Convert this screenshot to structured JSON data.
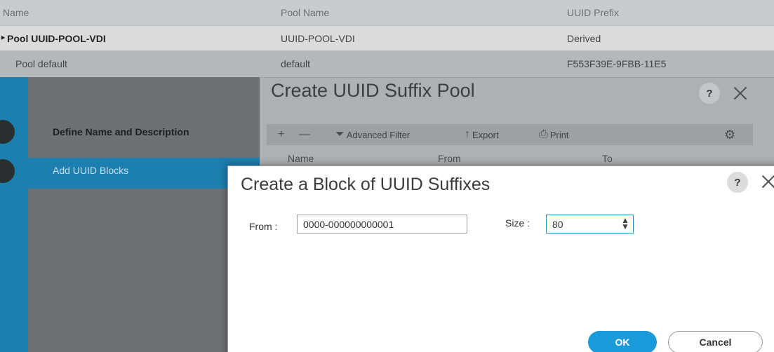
{
  "background_table": {
    "headers": [
      "Name",
      "Pool Name",
      "UUID Prefix"
    ],
    "rows": [
      {
        "name": "Pool UUID-POOL-VDI",
        "pool_name": "UUID-POOL-VDI",
        "prefix": "Derived"
      },
      {
        "name": "Pool default",
        "pool_name": "default",
        "prefix": "F553F39E-9FBB-11E5"
      }
    ]
  },
  "wizard": {
    "title": "Create UUID Suffix Pool",
    "help": "?",
    "steps": [
      "Define Name and Description",
      "Add UUID Blocks"
    ],
    "toolbar": {
      "advanced_filter": "Advanced Filter",
      "export": "Export",
      "print": "Print"
    },
    "columns": [
      "Name",
      "From",
      "To"
    ]
  },
  "modal": {
    "title": "Create a Block of UUID Suffixes",
    "help": "?",
    "from_label": "From :",
    "from_value": "0000-000000000001",
    "size_label": "Size :",
    "size_value": "80",
    "ok_label": "OK",
    "cancel_label": "Cancel"
  },
  "icons": {
    "add": "add-icon",
    "remove": "remove-icon",
    "filter": "filter-icon",
    "export": "export-icon",
    "print": "print-icon",
    "settings": "gear-icon",
    "close": "close-icon",
    "spinner": "spinner-icon"
  },
  "colors": {
    "accent": "#1d7fb0",
    "ok_button": "#1b9ad9"
  }
}
